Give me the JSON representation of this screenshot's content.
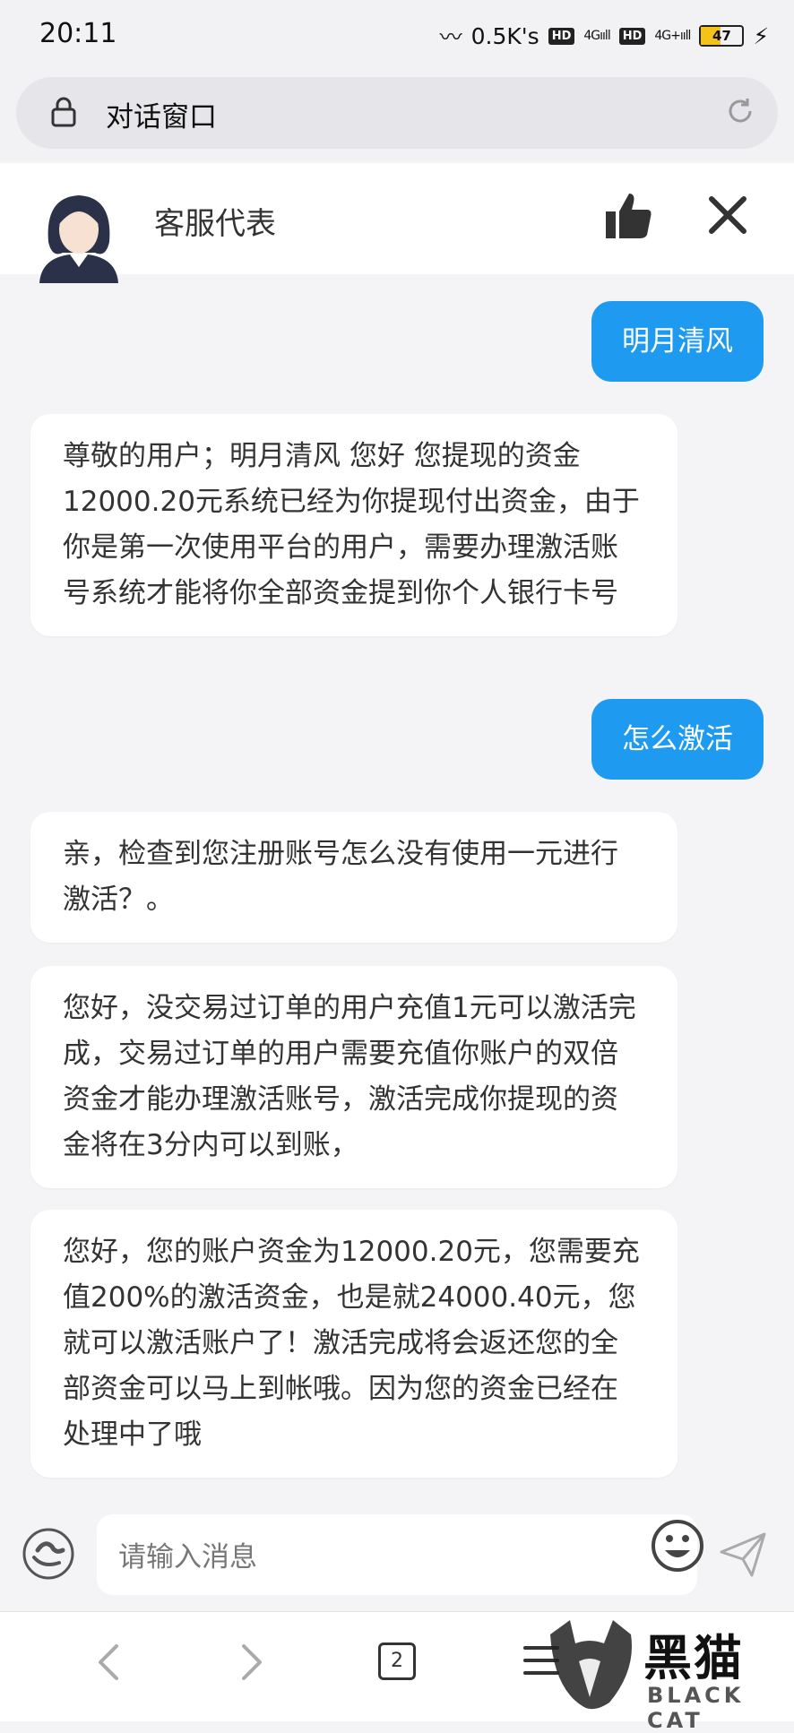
{
  "status": {
    "time": "20:11",
    "net_speed": "0.5K's",
    "hd1": "HD",
    "sig1": "4Gııll",
    "hd2": "HD",
    "sig2": "4G+ııll",
    "battery": "47"
  },
  "browser": {
    "title": "对话窗口"
  },
  "chat": {
    "agent_name": "客服代表",
    "messages": [
      {
        "from": "user",
        "text": "明月清风"
      },
      {
        "from": "agent",
        "text": "尊敬的用户；明月清风 您好 您提现的资金12000.20元系统已经为你提现付出资金，由于你是第一次使用平台的用户，需要办理激活账号系统才能将你全部资金提到你个人银行卡号"
      },
      {
        "from": "user",
        "text": "怎么激活"
      },
      {
        "from": "agent",
        "text": "亲，检查到您注册账号怎么没有使用一元进行激活？。"
      },
      {
        "from": "agent",
        "text": "您好，没交易过订单的用户充值1元可以激活完成，交易过订单的用户需要充值你账户的双倍资金才能办理激活账号，激活完成你提现的资金将在3分内可以到账，"
      },
      {
        "from": "agent",
        "text": "您好，您的账户资金为12000.20元，您需要充值200%的激活资金，也是就24000.40元，您就可以激活账户了！激活完成将会返还您的全部资金可以马上到帐哦。因为您的资金已经在处理中了哦"
      }
    ]
  },
  "input": {
    "placeholder": "请输入消息"
  },
  "nav": {
    "tab_count": "2"
  },
  "watermark": {
    "text": "黑猫",
    "sub": "BLACK CAT"
  },
  "colors": {
    "accent": "#1e9bf0"
  }
}
